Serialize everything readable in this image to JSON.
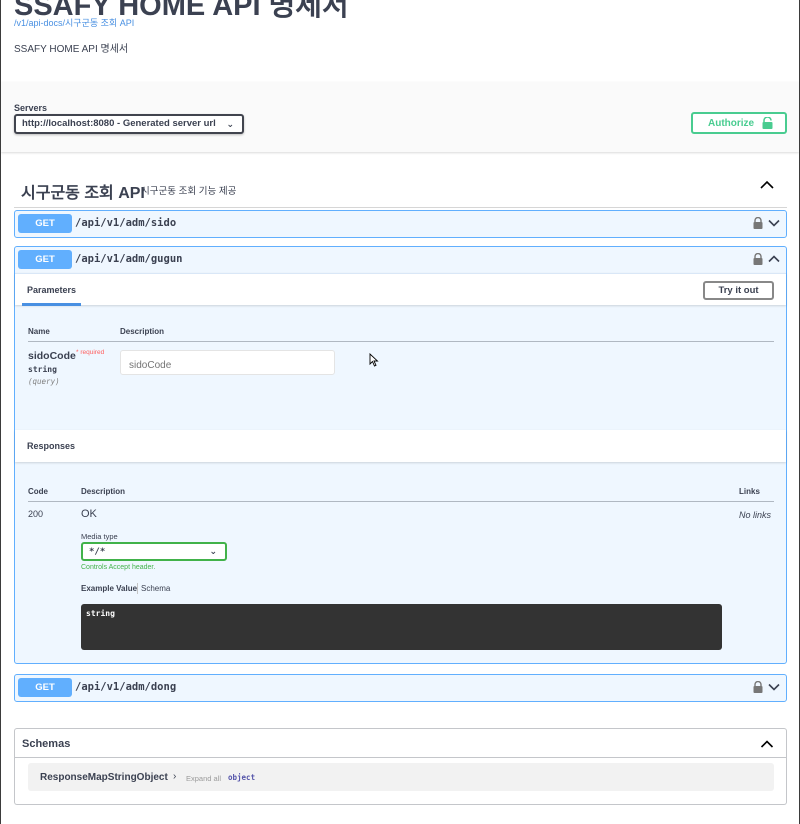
{
  "info": {
    "title": "SSAFY HOME API 명세서",
    "url": "/v1/api-docs/시구군동 조회 API",
    "description": "SSAFY HOME API 명세서"
  },
  "servers": {
    "label": "Servers",
    "selected": "http://localhost:8080 - Generated server url"
  },
  "authorize": {
    "label": "Authorize",
    "icon": "lock-open-icon"
  },
  "tag": {
    "name": "시구군동 조회 API",
    "description": "시구군동 조회 기능 제공"
  },
  "operations": [
    {
      "method": "GET",
      "path": "/api/v1/adm/sido",
      "expanded": false
    },
    {
      "method": "GET",
      "path": "/api/v1/adm/gugun",
      "expanded": true
    },
    {
      "method": "GET",
      "path": "/api/v1/adm/dong",
      "expanded": false
    }
  ],
  "gugun": {
    "params_tab": "Parameters",
    "try_button": "Try it out",
    "col_name": "Name",
    "col_description": "Description",
    "param": {
      "name": "sidoCode",
      "required": "* required",
      "type": "string",
      "in": "(query)",
      "placeholder": "sidoCode"
    },
    "responses_title": "Responses",
    "col_code": "Code",
    "col_resp_description": "Description",
    "col_links": "Links",
    "response": {
      "code": "200",
      "description": "OK",
      "links": "No links",
      "media_label": "Media type",
      "media_value": "*/*",
      "media_hint": "Controls Accept header.",
      "example_tab": "Example Value",
      "schema_tab": "Schema",
      "example": "string"
    }
  },
  "schemas": {
    "title": "Schemas",
    "model": {
      "name": "ResponseMapStringObject",
      "expand": "Expand all",
      "type": "object"
    }
  },
  "colors": {
    "get": "#61affe",
    "authorize": "#49cc90",
    "media_border": "#41b24a",
    "required": "#ff6060"
  }
}
